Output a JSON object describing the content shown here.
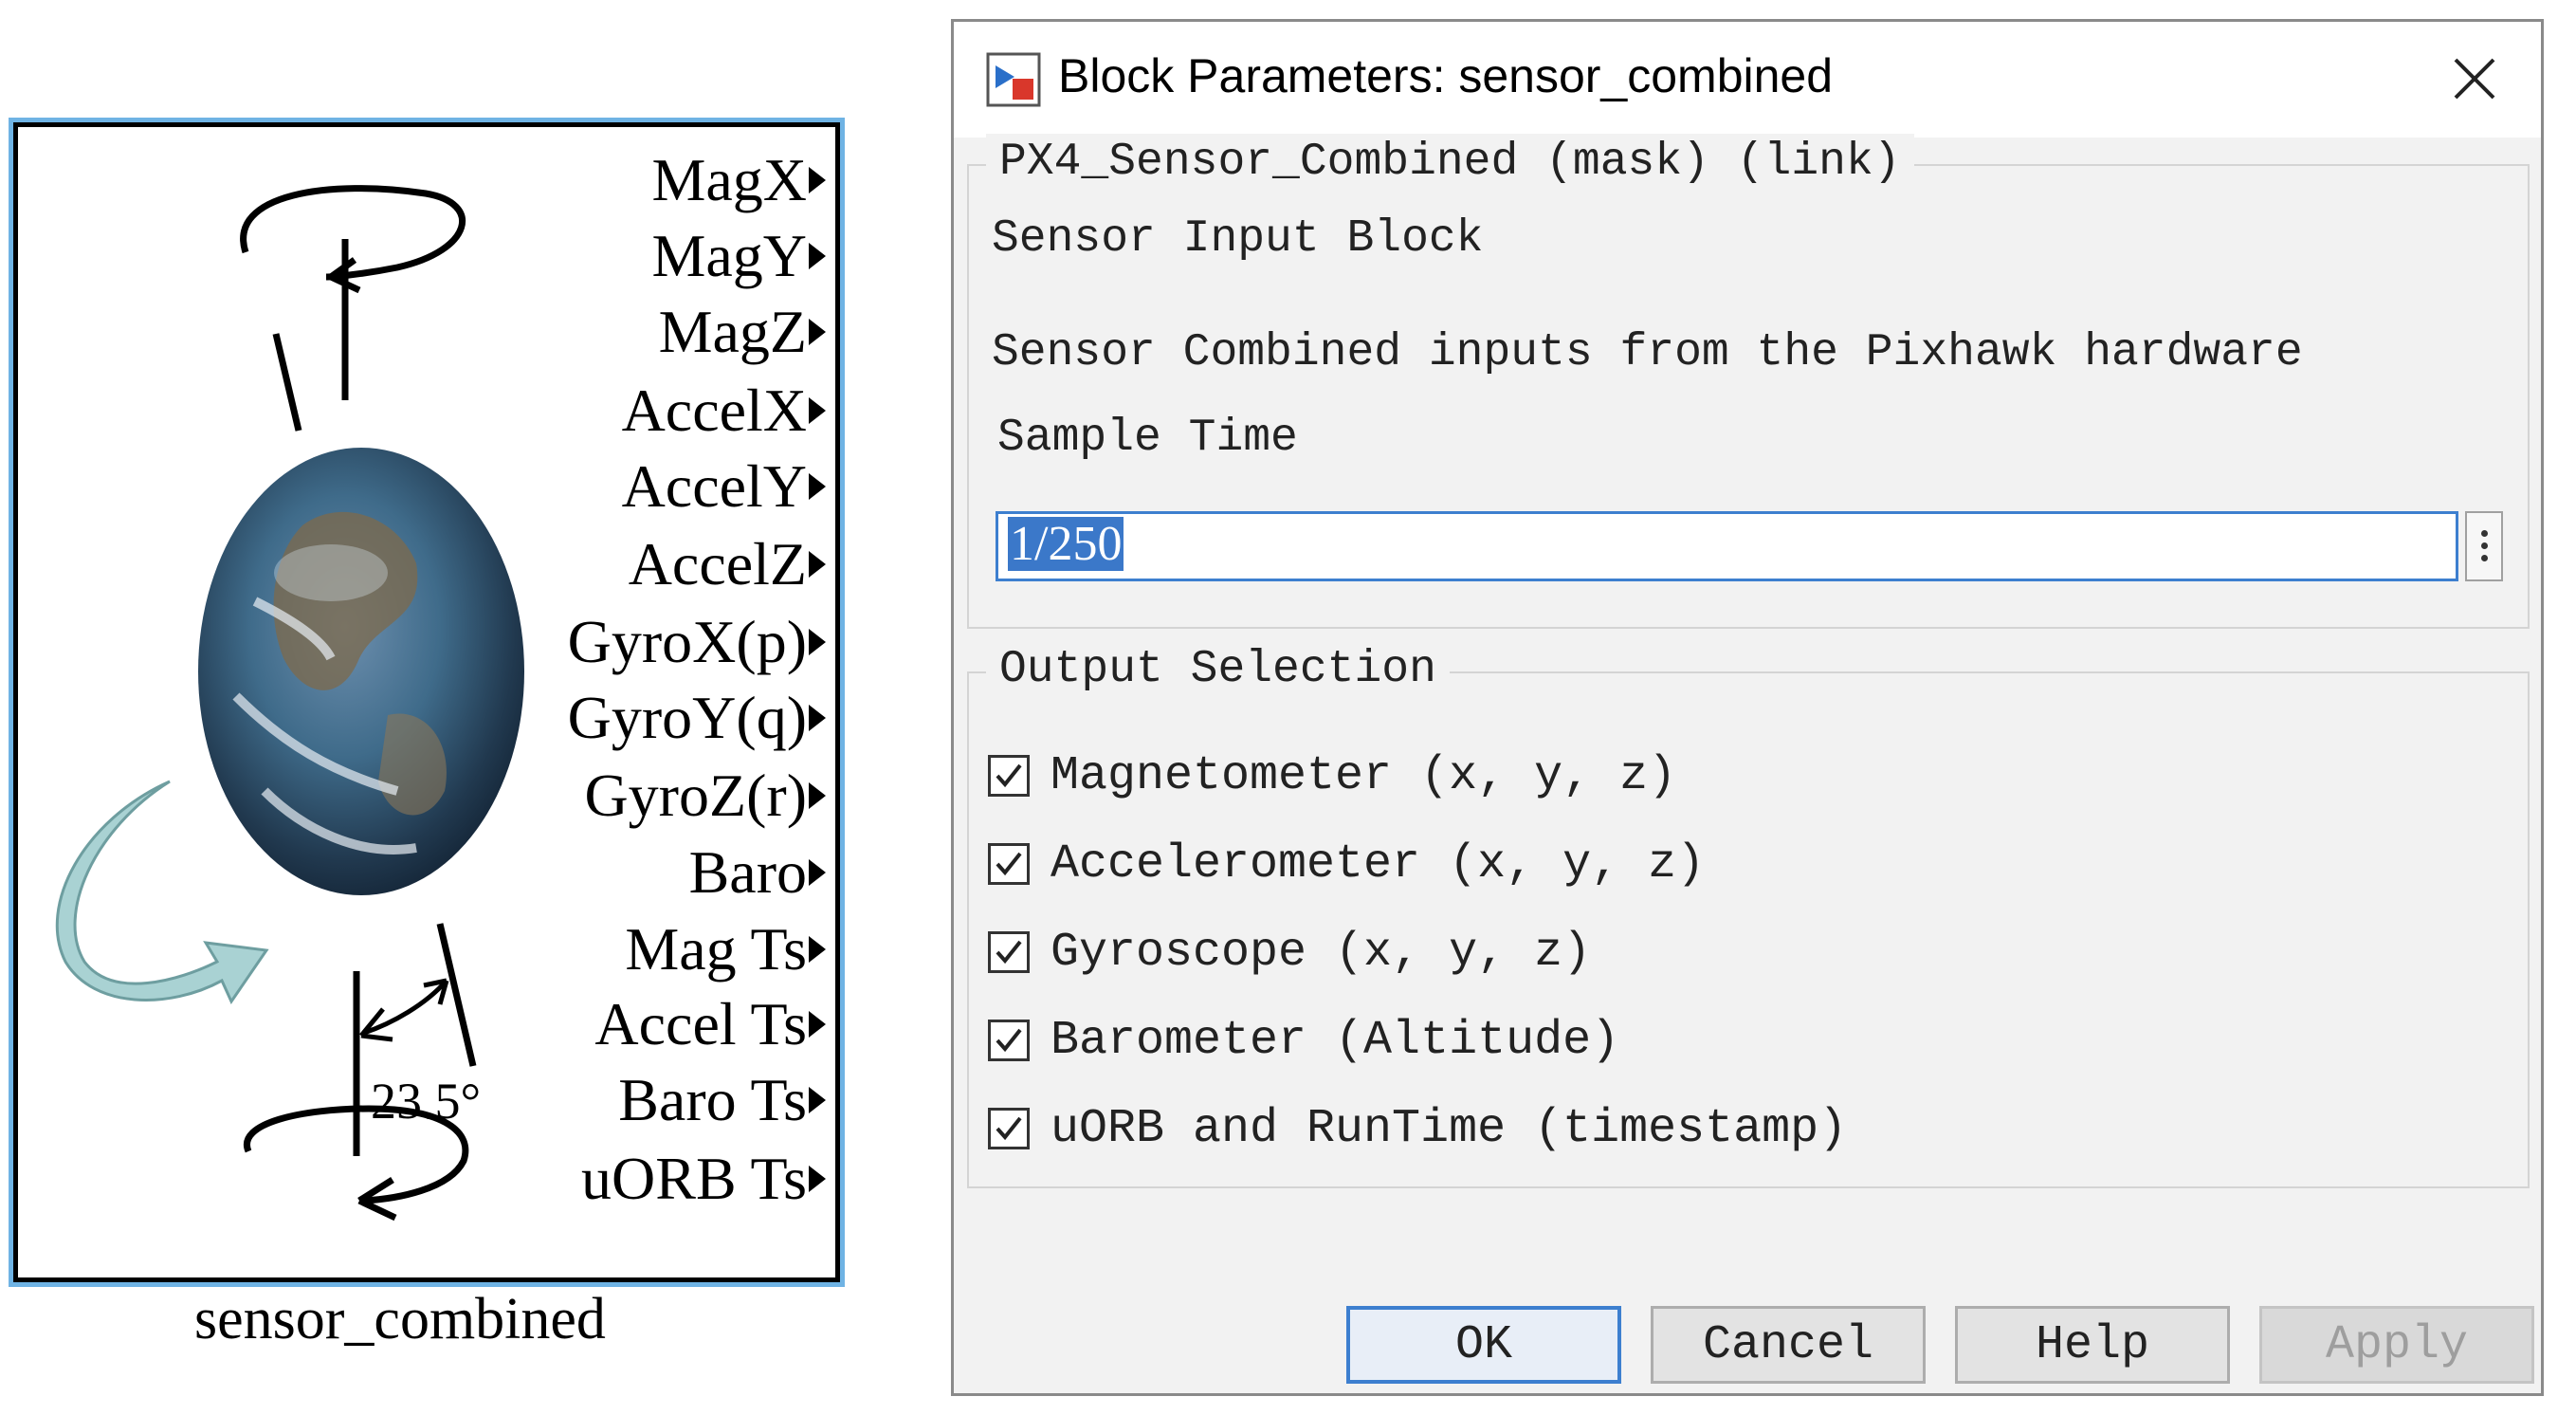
{
  "block": {
    "name": "sensor_combined",
    "angle_label": "23.5°",
    "ports": [
      "MagX",
      "MagY",
      "MagZ",
      "AccelX",
      "AccelY",
      "AccelZ",
      "GyroX(p)",
      "GyroY(q)",
      "GyroZ(r)",
      "Baro",
      "Mag Ts",
      "Accel Ts",
      "Baro Ts",
      "uORB Ts"
    ]
  },
  "dialog": {
    "title": "Block Parameters: sensor_combined",
    "title_icon": "simulink-block-icon",
    "close_icon": "close-icon",
    "mask_group": "PX4_Sensor_Combined (mask) (link)",
    "description_title": "Sensor Input Block",
    "description_text": "Sensor Combined inputs from the Pixhawk hardware",
    "sample_time_label": "Sample Time",
    "sample_time_value": "1/250",
    "output_group": "Output Selection",
    "checkboxes": [
      {
        "label": "Magnetometer (x, y, z)",
        "checked": true
      },
      {
        "label": "Accelerometer (x, y, z)",
        "checked": true
      },
      {
        "label": "Gyroscope (x, y, z)",
        "checked": true
      },
      {
        "label": "Barometer (Altitude)",
        "checked": true
      },
      {
        "label": "uORB and RunTime (timestamp)",
        "checked": true
      }
    ],
    "buttons": {
      "ok": "OK",
      "cancel": "Cancel",
      "help": "Help",
      "apply": "Apply"
    },
    "accent_color": "#3d7fcf",
    "apply_disabled": true
  }
}
